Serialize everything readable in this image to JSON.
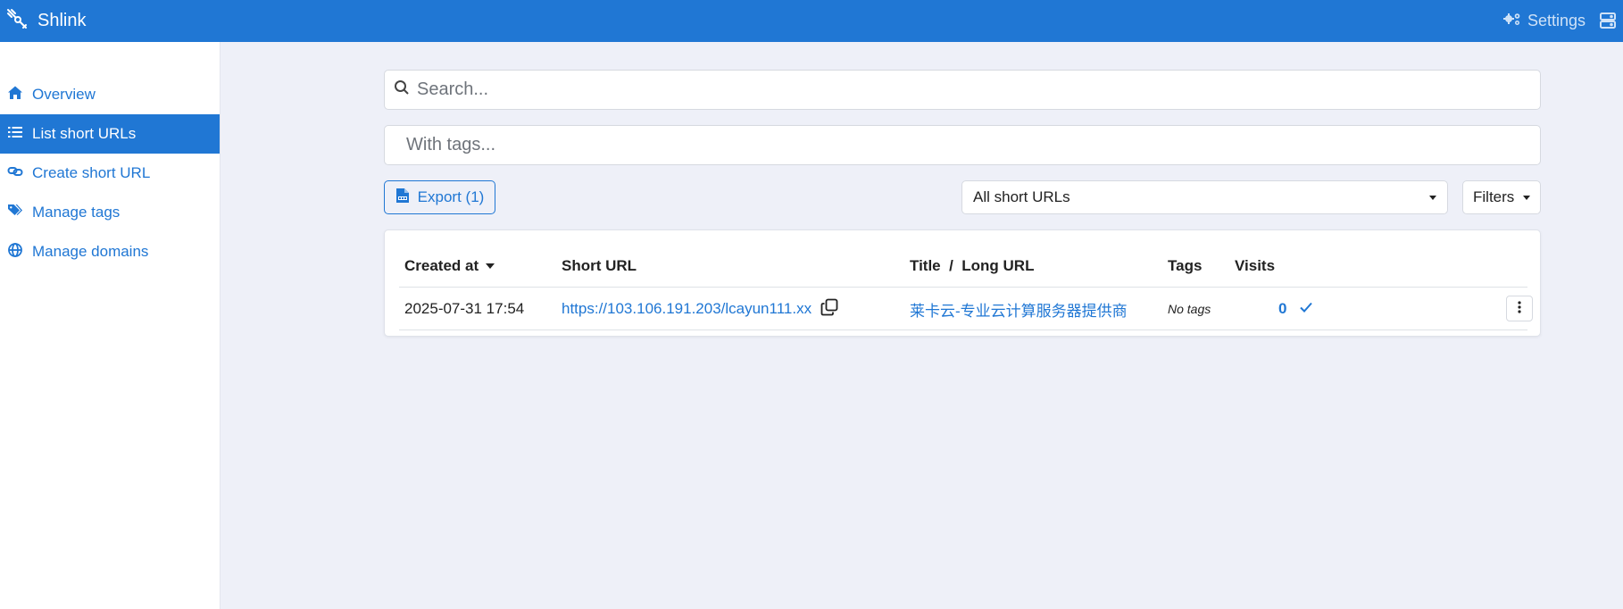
{
  "app": {
    "name": "Shlink"
  },
  "header": {
    "settings_label": "Settings"
  },
  "sidebar": {
    "items": [
      {
        "label": "Overview",
        "icon": "home-icon",
        "active": false
      },
      {
        "label": "List short URLs",
        "icon": "list-icon",
        "active": true
      },
      {
        "label": "Create short URL",
        "icon": "link-icon",
        "active": false
      },
      {
        "label": "Manage tags",
        "icon": "tags-icon",
        "active": false
      },
      {
        "label": "Manage domains",
        "icon": "globe-icon",
        "active": false
      }
    ]
  },
  "search": {
    "placeholder": "Search..."
  },
  "tags_input": {
    "placeholder": "With tags..."
  },
  "toolbar": {
    "export_label": "Export (1)",
    "filter_select_value": "All short URLs",
    "filters_label": "Filters"
  },
  "table": {
    "headers": {
      "created_at": "Created at",
      "short_url": "Short URL",
      "title_long_url": "Title  /  Long URL",
      "tags": "Tags",
      "visits": "Visits"
    },
    "rows": [
      {
        "created_at": "2025-07-31 17:54",
        "short_url": "https://103.106.191.203/lcayun111.xx",
        "title": "莱卡云-专业云计算服务器提供商",
        "tags": "No tags",
        "visits": "0"
      }
    ]
  },
  "colors": {
    "brand": "#2077d4",
    "background": "#eef0f8",
    "surface": "#ffffff"
  }
}
